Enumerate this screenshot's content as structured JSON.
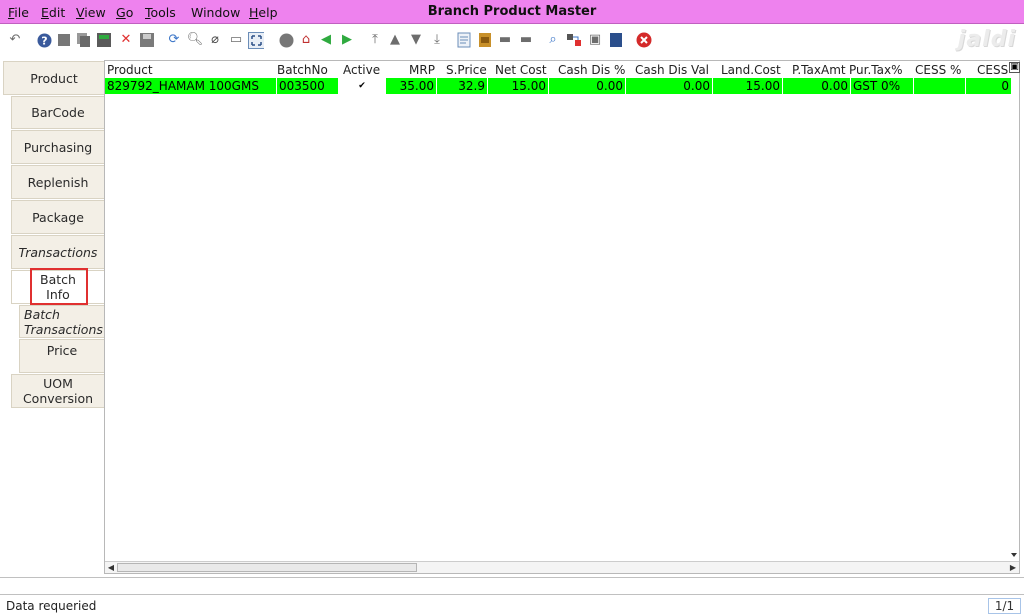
{
  "window": {
    "title": "Branch Product Master",
    "logo_text": "jaldi"
  },
  "menu": [
    {
      "label": "File",
      "accel": "F",
      "rest": "ile"
    },
    {
      "label": "Edit",
      "accel": "E",
      "rest": "dit"
    },
    {
      "label": "View",
      "accel": "V",
      "rest": "iew"
    },
    {
      "label": "Go",
      "accel": "G",
      "rest": "o"
    },
    {
      "label": "Tools",
      "accel": "T",
      "rest": "ools"
    },
    {
      "label": "Window",
      "accel": "",
      "rest": "Window"
    },
    {
      "label": "Help",
      "accel": "H",
      "rest": "elp"
    }
  ],
  "tabs": [
    {
      "label": "Product"
    },
    {
      "label": "BarCode"
    },
    {
      "label": "Purchasing"
    },
    {
      "label": "Replenish"
    },
    {
      "label": "Package"
    },
    {
      "label": "Transactions"
    },
    {
      "label": "Batch Info",
      "selected": true
    },
    {
      "label": "Batch Transactions"
    },
    {
      "label": "Price"
    },
    {
      "label": "UOM Conversion"
    }
  ],
  "grid": {
    "columns": [
      "Product",
      "BatchNo",
      "Active",
      "MRP",
      "S.Price",
      "Net Cost",
      "Cash Dis %",
      "Cash Dis Val",
      "Land.Cost",
      "P.TaxAmt",
      "Pur.Tax%",
      "CESS %",
      "CESS"
    ],
    "rows": [
      {
        "product": "829792_HAMAM 100GMS",
        "batch_no": "003500",
        "active": true,
        "active_glyph": "✔",
        "mrp": "35.00",
        "s_price": "32.9",
        "net_cost": "15.00",
        "cash_dis_pct": "0.00",
        "cash_dis_val": "0.00",
        "land_cost": "15.00",
        "p_tax_amt": "0.00",
        "pur_tax_pct": "GST 0%",
        "cess_pct": "",
        "cess": "0"
      }
    ],
    "row_color": "#00ff00"
  },
  "status": {
    "message": "Data requeried",
    "page": "1/1"
  },
  "colors": {
    "title_bar": "#ee82ee",
    "selected_row": "#00ff00",
    "highlight_box": "#e03030"
  }
}
